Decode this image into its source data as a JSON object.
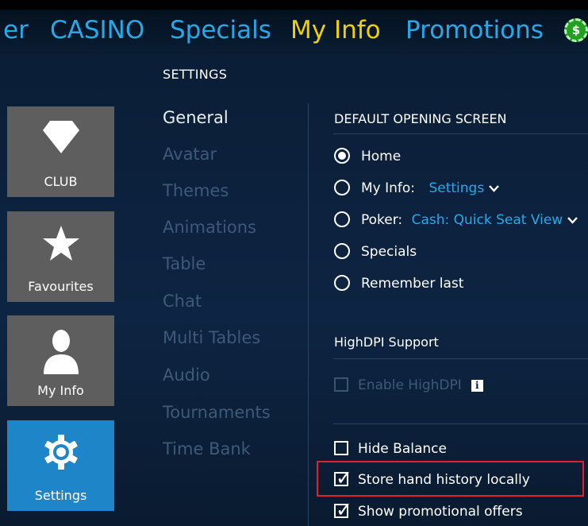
{
  "topnav": {
    "items": [
      {
        "label": "er",
        "state": "normal"
      },
      {
        "label": "CASINO",
        "state": "normal"
      },
      {
        "label": "Specials",
        "state": "normal"
      },
      {
        "label": "My Info",
        "state": "active"
      },
      {
        "label": "Promotions",
        "state": "normal"
      }
    ],
    "chip_icon": "poker-chip-icon",
    "chip_symbol": "$"
  },
  "page": {
    "section_title": "SETTINGS"
  },
  "sidebar": {
    "tiles": [
      {
        "label": "CLUB",
        "icon": "diamond-icon",
        "active": false
      },
      {
        "label": "Favourites",
        "icon": "star-icon",
        "active": false
      },
      {
        "label": "My Info",
        "icon": "person-icon",
        "active": false
      },
      {
        "label": "Settings",
        "icon": "gear-icon",
        "active": true
      }
    ]
  },
  "settings_menu": {
    "items": [
      {
        "label": "General",
        "active": true
      },
      {
        "label": "Avatar",
        "active": false
      },
      {
        "label": "Themes",
        "active": false
      },
      {
        "label": "Animations",
        "active": false
      },
      {
        "label": "Table",
        "active": false
      },
      {
        "label": "Chat",
        "active": false
      },
      {
        "label": "Multi Tables",
        "active": false
      },
      {
        "label": "Audio",
        "active": false
      },
      {
        "label": "Tournaments",
        "active": false
      },
      {
        "label": "Time Bank",
        "active": false
      }
    ]
  },
  "general": {
    "opening_screen": {
      "heading": "DEFAULT OPENING SCREEN",
      "options": [
        {
          "label": "Home",
          "selected": true
        },
        {
          "label": "My Info:",
          "selected": false,
          "dropdown_value": "Settings"
        },
        {
          "label": "Poker:",
          "selected": false,
          "dropdown_value": "Cash: Quick Seat View"
        },
        {
          "label": "Specials",
          "selected": false
        },
        {
          "label": "Remember last",
          "selected": false
        }
      ]
    },
    "highdpi": {
      "heading": "HighDPI Support",
      "enable_label": "Enable HighDPI",
      "enable_checked": false,
      "enable_disabled": true,
      "info_icon": "info-icon",
      "info_symbol": "i"
    },
    "checkboxes": [
      {
        "label": "Hide Balance",
        "checked": false
      },
      {
        "label": "Store hand history locally",
        "checked": true,
        "highlighted": true
      },
      {
        "label": "Show promotional offers",
        "checked": true
      }
    ]
  },
  "colors": {
    "accent": "#29a8e8",
    "active_nav": "#f2d000",
    "active_tile": "#1e86c8",
    "highlight_border": "#e0202a",
    "background": "#0b1b30"
  }
}
